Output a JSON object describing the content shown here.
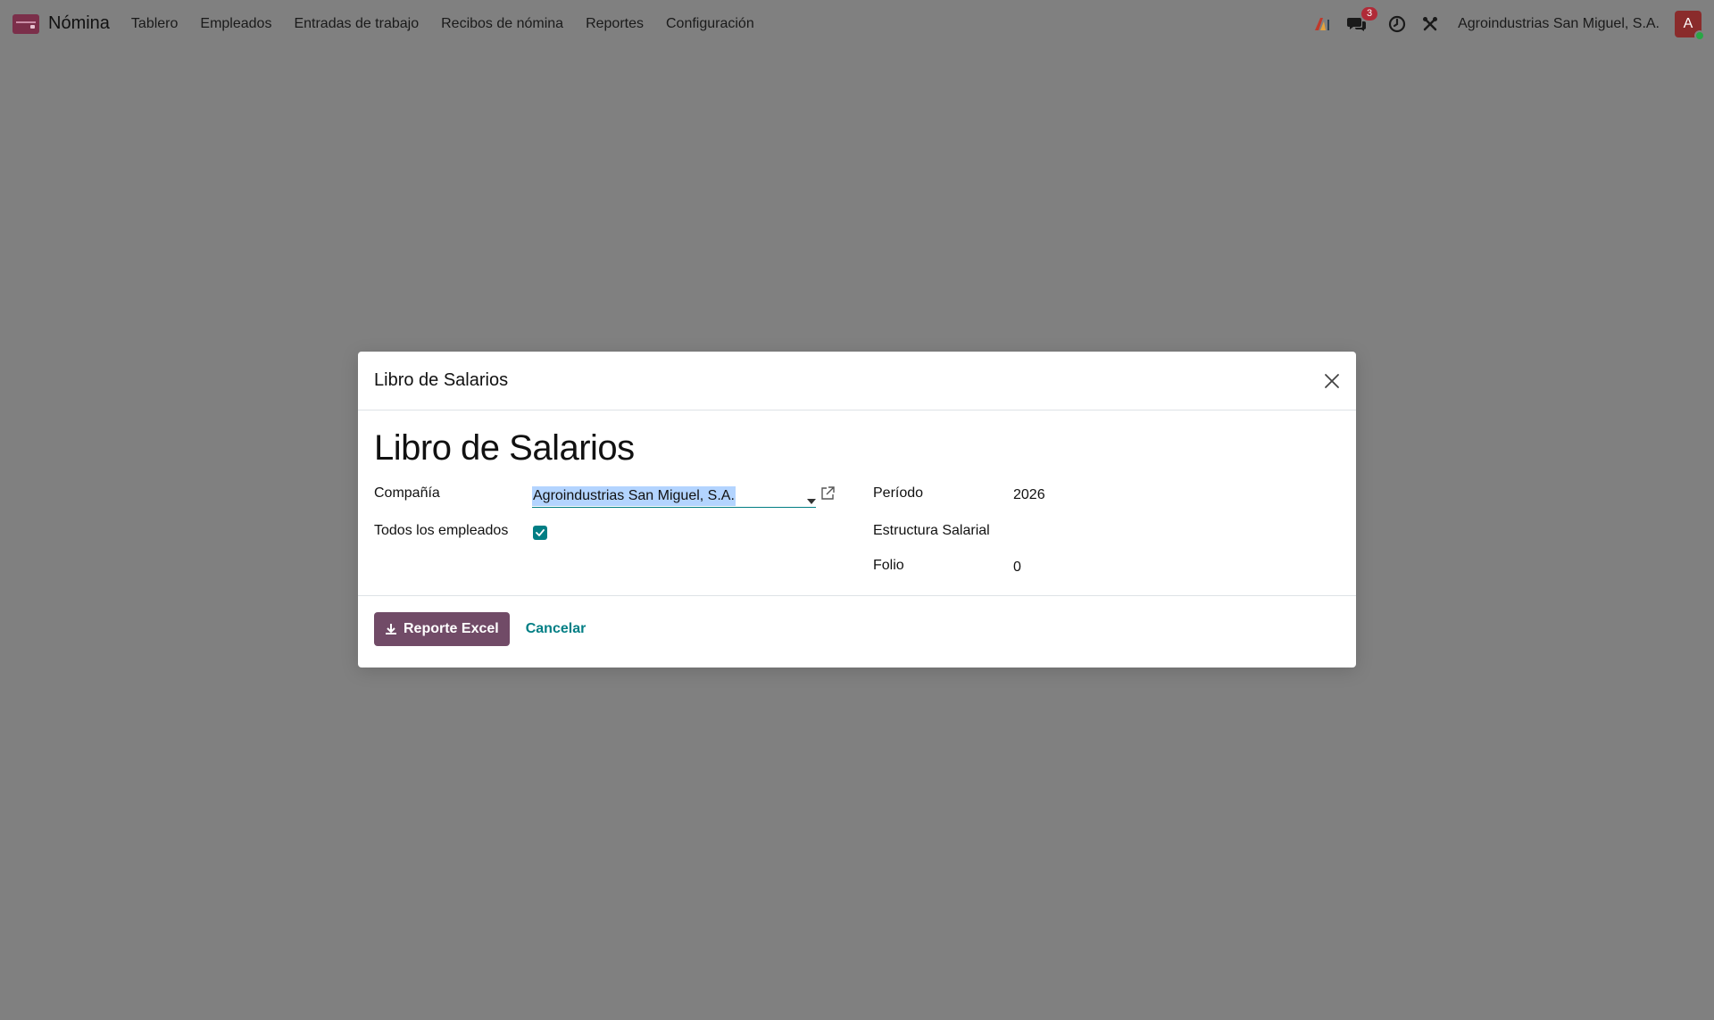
{
  "navbar": {
    "app_name": "Nómina",
    "menu": [
      {
        "label": "Tablero"
      },
      {
        "label": "Empleados"
      },
      {
        "label": "Entradas de trabajo"
      },
      {
        "label": "Recibos de nómina"
      },
      {
        "label": "Reportes"
      },
      {
        "label": "Configuración"
      }
    ],
    "messages_badge": "3",
    "company": "Agroindustrias San Miguel, S.A.",
    "avatar_initial": "A"
  },
  "icons": {
    "app": "payroll-app-icon",
    "assistant": "assistant-logo-icon",
    "messages": "chat-bubbles-icon",
    "activity": "clock-icon",
    "debug": "tools-icon",
    "close": "close-icon",
    "dropdown": "caret-down-icon",
    "external": "external-link-icon",
    "checkbox": "check-icon",
    "download": "download-icon"
  },
  "colors": {
    "backdrop": "#808080",
    "primary": "#714b67",
    "accent": "#017e84",
    "badge": "#b02a37",
    "selection": "#b3d4ff"
  },
  "modal": {
    "title": "Libro de Salarios",
    "heading": "Libro de Salarios",
    "fields": {
      "company_label": "Compañía",
      "company_value": "Agroindustrias San Miguel, S.A.",
      "all_employees_label": "Todos los empleados",
      "all_employees_checked": true,
      "period_label": "Período",
      "period_value": "2026",
      "structure_label": "Estructura Salarial",
      "structure_value": "",
      "folio_label": "Folio",
      "folio_value": "0"
    },
    "footer": {
      "primary_label": "Reporte Excel",
      "cancel_label": "Cancelar"
    }
  }
}
